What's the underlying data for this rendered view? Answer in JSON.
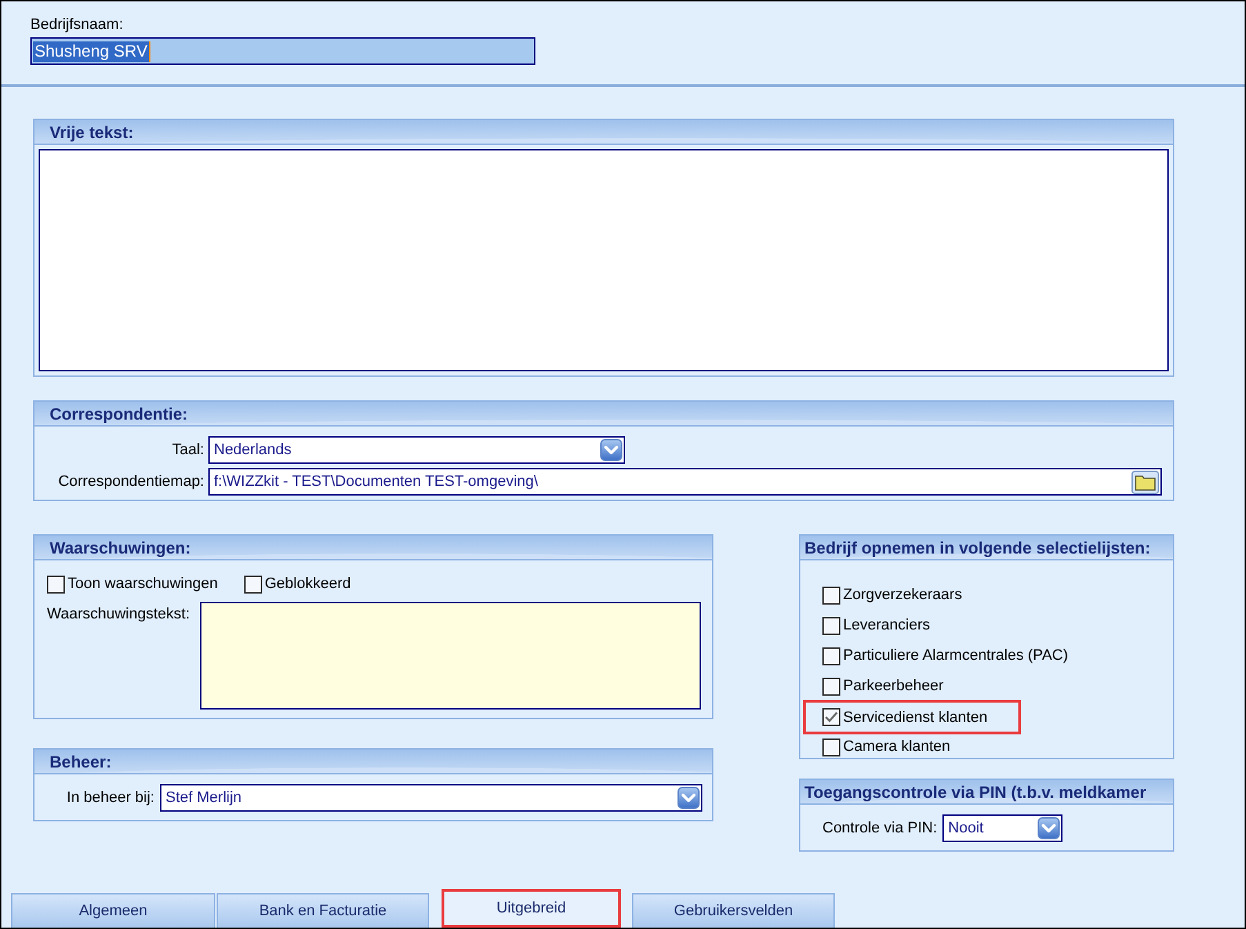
{
  "company_name": {
    "label": "Bedrijfsnaam:",
    "value": "Shusheng SRV",
    "text_selected": true
  },
  "free_text": {
    "title": "Vrije tekst:"
  },
  "correspondence": {
    "title": "Correspondentie:",
    "language": {
      "label": "Taal:",
      "value": "Nederlands"
    },
    "folder": {
      "label": "Correspondentiemap:",
      "value": "f:\\WIZZkit - TEST\\Documenten TEST-omgeving\\"
    }
  },
  "warnings": {
    "title": "Waarschuwingen:",
    "options": [
      {
        "label": "Toon waarschuwingen",
        "checked": false
      },
      {
        "label": "Geblokkeerd",
        "checked": false
      }
    ],
    "text_label": "Waarschuwingstekst:"
  },
  "management": {
    "title": "Beheer:",
    "label": "In beheer bij:",
    "value": "Stef Merlijn"
  },
  "selection_lists": {
    "title": "Bedrijf opnemen in volgende selectielijsten:",
    "items": [
      {
        "label": "Zorgverzekeraars",
        "checked": false,
        "highlighted": false
      },
      {
        "label": "Leveranciers",
        "checked": false,
        "highlighted": false
      },
      {
        "label": "Particuliere Alarmcentrales (PAC)",
        "checked": false,
        "highlighted": false
      },
      {
        "label": "Parkeerbeheer",
        "checked": false,
        "highlighted": false
      },
      {
        "label": "Servicedienst klanten",
        "checked": true,
        "highlighted": true
      },
      {
        "label": "Camera klanten",
        "checked": false,
        "highlighted": false
      }
    ]
  },
  "pin_control": {
    "title": "Toegangscontrole via PIN (t.b.v. meldkamer",
    "label": "Controle via PIN:",
    "value": "Nooit"
  },
  "tabs": [
    {
      "label": "Algemeen",
      "selected": false,
      "highlighted": false
    },
    {
      "label": "Bank en Facturatie",
      "selected": false,
      "highlighted": false
    },
    {
      "label": "Uitgebreid",
      "selected": true,
      "highlighted": true
    },
    {
      "label": "Gebruikersvelden",
      "selected": false,
      "highlighted": false
    }
  ]
}
